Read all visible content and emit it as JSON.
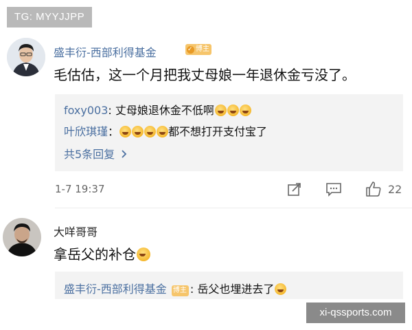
{
  "corner_badge": "TG: MYYJJPP",
  "comments": [
    {
      "username": "盛丰衍-西部利得基金",
      "verified_label": "博主",
      "text": "毛估估，这一个月把我丈母娘一年退休金亏没了。",
      "replies": [
        {
          "user": "foxy003",
          "text": "丈母娘退休金不低啊",
          "emoji_count": 3
        },
        {
          "user": "叶欣琪瑾",
          "text": "都不想打开支付宝了",
          "emoji_count": 4
        }
      ],
      "more_replies": "共5条回复",
      "timestamp": "1-7 19:37",
      "likes": "22"
    },
    {
      "username": "大咩哥哥",
      "text": "拿岳父的补仓",
      "replies": [
        {
          "user": "盛丰衍-西部利得基金",
          "verified_label": "博主",
          "text": "岳父也埋进去了"
        }
      ]
    }
  ],
  "watermark": "xi-qssports.com",
  "icons": [
    "share-icon",
    "comment-icon",
    "like-icon",
    "chevron-right-icon",
    "laugh-emoji-icon",
    "smile-emoji-icon"
  ],
  "colors": {
    "link": "#4a6fa0",
    "verified": "#f6c56b",
    "reply_bg": "#f3f3f3"
  }
}
